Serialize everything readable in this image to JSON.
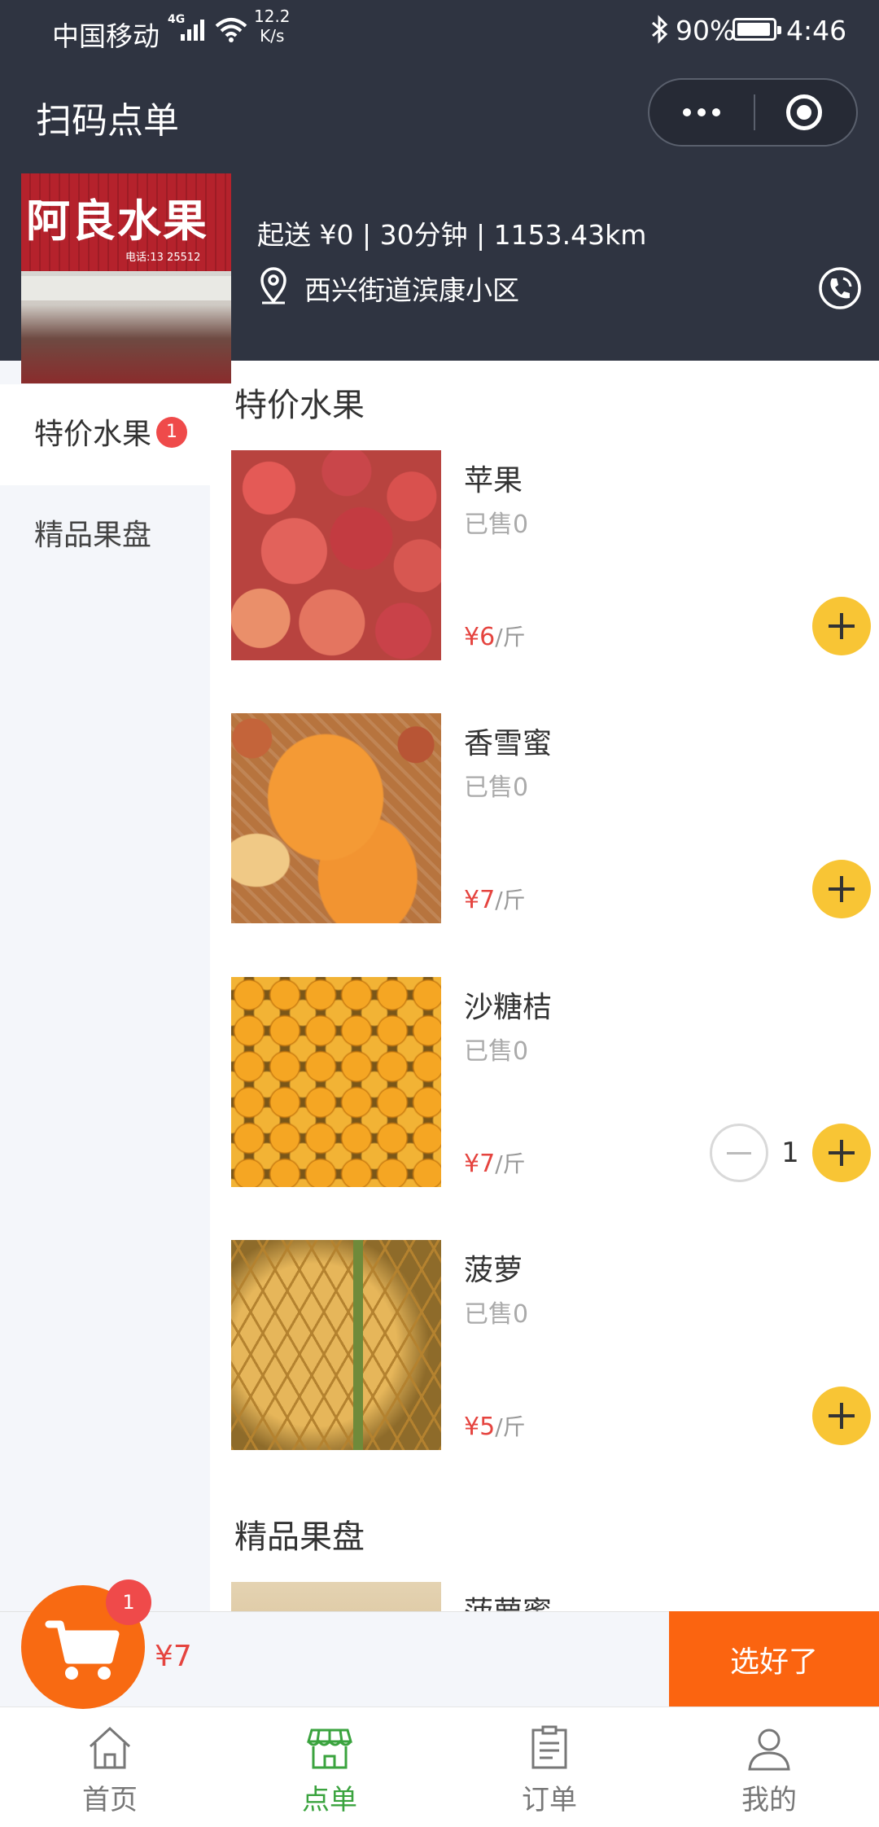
{
  "status_bar": {
    "carrier": "中国移动",
    "network": "4G",
    "speed": "12.2",
    "speed_unit": "K/s",
    "battery": "90%",
    "battery_level": 0.9,
    "time": "4:46"
  },
  "navbar": {
    "title": "扫码点单"
  },
  "shop": {
    "sign_text": "阿良水果",
    "sign_phone": "电话:13    25512",
    "info": "起送 ¥0 | 30分钟 | 1153.43km",
    "location": "西兴街道滨康小区"
  },
  "categories": [
    {
      "label": "特价水果",
      "badge": "1",
      "active": true
    },
    {
      "label": "精品果盘",
      "badge": "",
      "active": false
    }
  ],
  "sections": [
    {
      "title": "特价水果"
    },
    {
      "title": "精品果盘"
    }
  ],
  "products": [
    {
      "name": "苹果",
      "sold": "已售0",
      "price": "¥6",
      "unit": "/斤",
      "qty": ""
    },
    {
      "name": "香雪蜜",
      "sold": "已售0",
      "price": "¥7",
      "unit": "/斤",
      "qty": ""
    },
    {
      "name": "沙糖桔",
      "sold": "已售0",
      "price": "¥7",
      "unit": "/斤",
      "qty": "1"
    },
    {
      "name": "菠萝",
      "sold": "已售0",
      "price": "¥5",
      "unit": "/斤",
      "qty": ""
    },
    {
      "name": "菠萝蜜",
      "sold": "",
      "price": "",
      "unit": "",
      "qty": ""
    }
  ],
  "cart": {
    "badge": "1",
    "total": "¥7",
    "checkout_label": "选好了"
  },
  "tabbar": [
    {
      "label": "首页",
      "icon": "home-icon",
      "active": false
    },
    {
      "label": "点单",
      "icon": "store-icon",
      "active": true
    },
    {
      "label": "订单",
      "icon": "order-icon",
      "active": false
    },
    {
      "label": "我的",
      "icon": "user-icon",
      "active": false
    }
  ],
  "colors": {
    "header_bg": "#2f3441",
    "accent_yellow": "#f8c535",
    "cart_orange": "#f86a12",
    "price_red": "#e5443f",
    "tab_active": "#3aa33e"
  }
}
